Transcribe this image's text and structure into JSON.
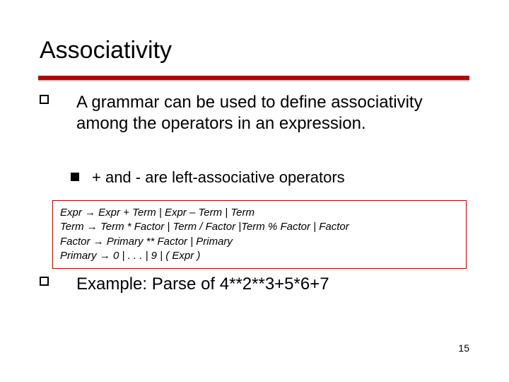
{
  "title": "Associativity",
  "bullets": {
    "main": "A grammar can be used to define associativity among the operators in an expression.",
    "sub": "+ and - are left-associative operators",
    "example": "Example: Parse of 4**2**3+5*6+7"
  },
  "grammar": {
    "line1": "Expr → Expr + Term | Expr – Term | Term",
    "line2": "Term → Term * Factor | Term / Factor |Term % Factor | Factor",
    "line3": "Factor → Primary ** Factor | Primary",
    "line4": "Primary → 0 | . . . | 9 | ( Expr )"
  },
  "page_number": "15"
}
